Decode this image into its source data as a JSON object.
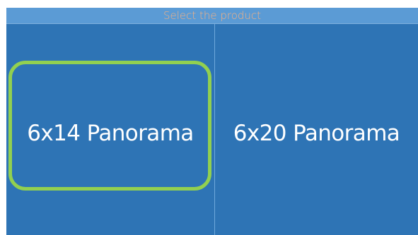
{
  "header": {
    "title": "Select the product"
  },
  "products": [
    {
      "label": "6x14 Panorama",
      "selected": true
    },
    {
      "label": "6x20 Panorama",
      "selected": false
    }
  ],
  "colors": {
    "background": "#2e74b5",
    "header_background": "#5b9bd5",
    "header_text": "#f4b183",
    "selection_outline": "#92d050",
    "tile_text": "#ffffff"
  }
}
